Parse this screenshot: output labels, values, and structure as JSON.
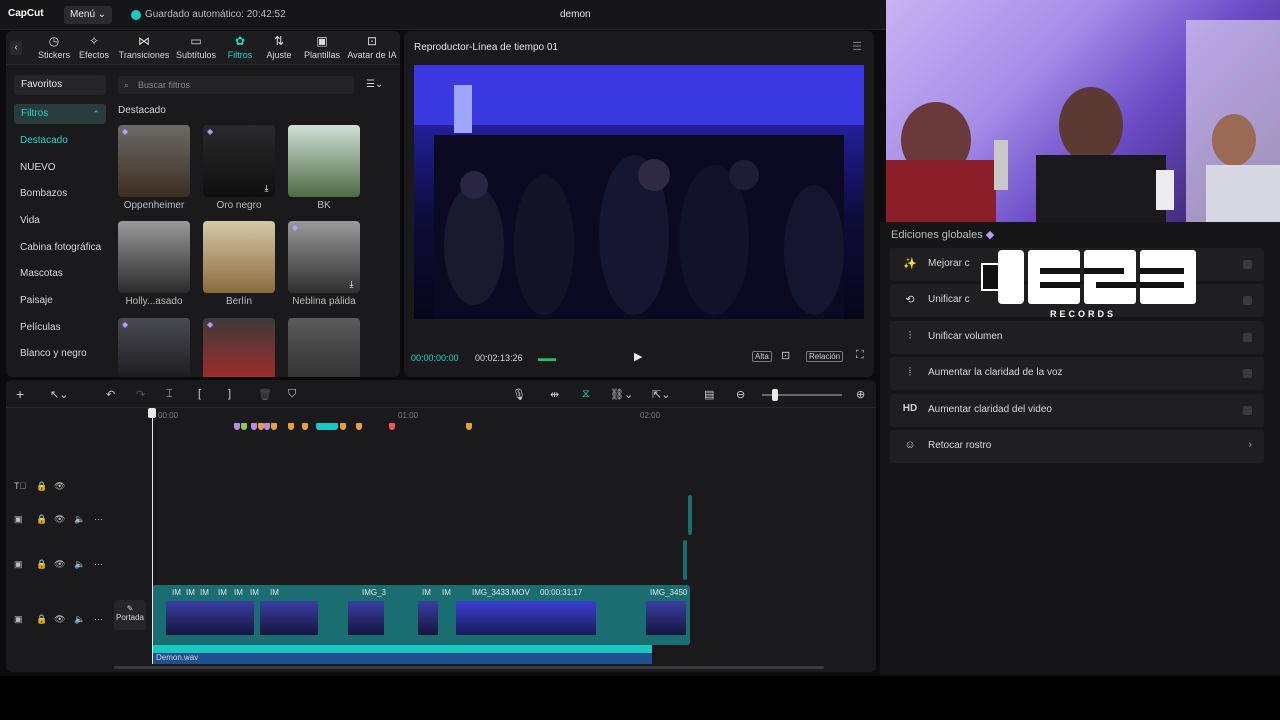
{
  "app": {
    "logo": "CapCut",
    "menu_label": "Menú",
    "autosave": "Guardado automático: 20:42:52",
    "project_title": "demon"
  },
  "toolbar": {
    "tabs": [
      {
        "label": "Stickers",
        "icon": "sticker-icon"
      },
      {
        "label": "Efectos",
        "icon": "effects-icon"
      },
      {
        "label": "Transiciones",
        "icon": "transition-icon"
      },
      {
        "label": "Subtítulos",
        "icon": "subtitle-icon"
      },
      {
        "label": "Filtros",
        "icon": "filter-icon",
        "active": true
      },
      {
        "label": "Ajuste",
        "icon": "adjust-icon"
      },
      {
        "label": "Plantillas",
        "icon": "template-icon"
      },
      {
        "label": "Avatar de IA",
        "icon": "ai-avatar-icon"
      }
    ]
  },
  "sidebar": {
    "favorites": "Favoritos",
    "filters": "Filtros",
    "items": [
      "Destacado",
      "NUEVO",
      "Bombazos",
      "Vida",
      "Cabina fotográfica",
      "Mascotas",
      "Paisaje",
      "Películas",
      "Blanco y negro"
    ]
  },
  "filters": {
    "search_placeholder": "Buscar filtros",
    "section_title": "Destacado",
    "thumbs": [
      {
        "label": "Oppenheimer"
      },
      {
        "label": "Oro negro"
      },
      {
        "label": "BK"
      },
      {
        "label": "Holly...asado"
      },
      {
        "label": "Berlín"
      },
      {
        "label": "Neblina pálida"
      },
      {
        "label": ""
      },
      {
        "label": ""
      },
      {
        "label": ""
      }
    ]
  },
  "player": {
    "title": "Reproductor-Línea de tiempo 01",
    "time_current": "00:00:00:00",
    "time_total": "00:02:13:26",
    "btn_quality": "Alta",
    "btn_ratio": "Relación"
  },
  "timeline": {
    "ruler": [
      "00:00",
      "01:00",
      "02:00"
    ],
    "cover_label": "Portada",
    "clips": [
      {
        "label": "IM"
      },
      {
        "label": "IM"
      },
      {
        "label": "IM"
      },
      {
        "label": "IM"
      },
      {
        "label": "IM"
      },
      {
        "label": "IM"
      },
      {
        "label": "IM"
      },
      {
        "label": "IMG_3"
      },
      {
        "label": "IM"
      },
      {
        "label": "IM"
      },
      {
        "label": "IMG_3433.MOV"
      },
      {
        "label": "00:00:31:17"
      },
      {
        "label": "IMG_3450"
      }
    ],
    "audio_label": "Demon.wav"
  },
  "right_panel": {
    "title": "Ediciones globales",
    "options": [
      {
        "label": "Mejorar c",
        "icon": "magic-wand-icon",
        "action": "toggle"
      },
      {
        "label": "Unificar c",
        "icon": "unify-color-icon",
        "action": "toggle"
      },
      {
        "label": "Unificar volumen",
        "icon": "equalizer-icon",
        "action": "toggle"
      },
      {
        "label": "Aumentar la claridad de la voz",
        "icon": "voice-wave-icon",
        "action": "toggle"
      },
      {
        "label": "Aumentar claridad del video",
        "icon": "hd-icon",
        "action": "toggle"
      },
      {
        "label": "Retocar rostro",
        "icon": "face-retouch-icon",
        "action": "chevron"
      }
    ]
  },
  "overlay_logo": {
    "text": "OES3",
    "subtitle": "RECORDS"
  },
  "colors": {
    "accent": "#1fd6ca",
    "panel": "#1a1a1c",
    "clip": "#1a6d70"
  }
}
